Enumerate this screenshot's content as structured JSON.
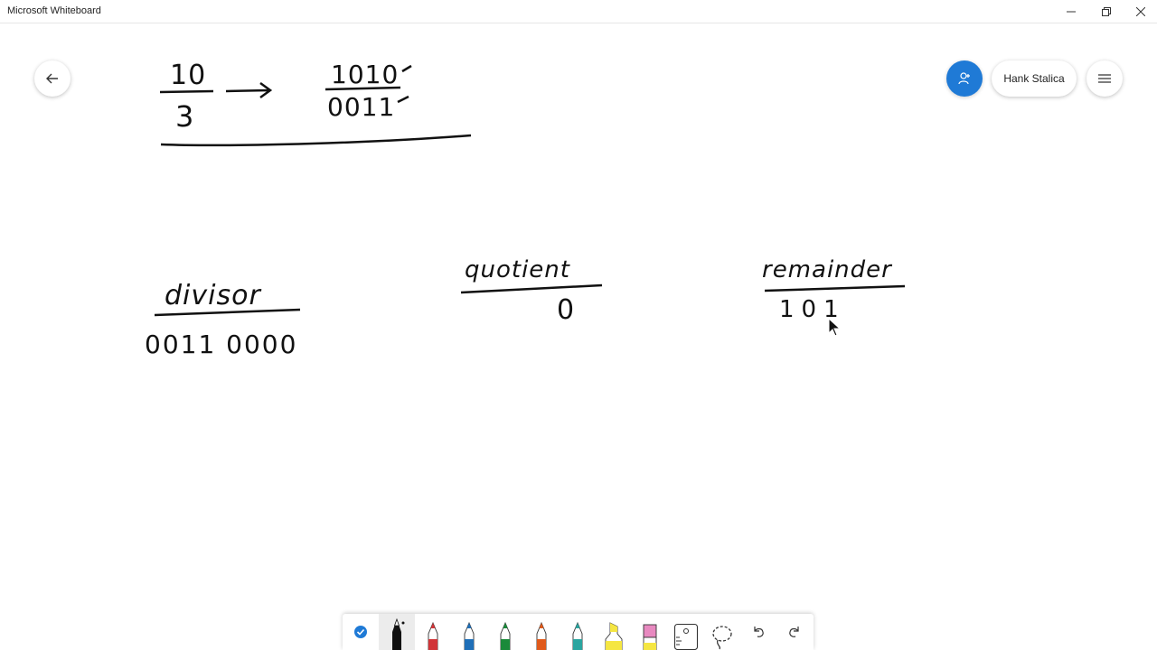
{
  "window": {
    "title": "Microsoft Whiteboard",
    "minimize_icon": "minimize-icon",
    "restore_icon": "restore-icon",
    "close_icon": "close-icon"
  },
  "header": {
    "back_icon": "back-arrow-icon",
    "user_name": "Hank Stalica",
    "invite_icon": "person-add-icon",
    "menu_icon": "hamburger-menu-icon",
    "accent_color": "#1f7ad6"
  },
  "board": {
    "fraction_numerator": "10",
    "fraction_denominator": "3",
    "binary_numerator": "1010",
    "binary_denominator": "0011",
    "divisor_label": "divisor",
    "divisor_value": "0011 0000",
    "quotient_label": "quotient",
    "quotient_value": "0",
    "remainder_label": "remainder",
    "remainder_value": "101"
  },
  "toolbar": {
    "tools": [
      {
        "name": "ink-to-shape-toggle",
        "icon": "checkmark-circle-icon",
        "color": "#1f7ad6"
      },
      {
        "name": "pen-black",
        "icon": "pen-icon",
        "color": "#111111",
        "selected": true
      },
      {
        "name": "pen-red",
        "icon": "pen-icon",
        "color": "#d13438"
      },
      {
        "name": "pen-blue",
        "icon": "pen-icon",
        "color": "#1f6fb8"
      },
      {
        "name": "pen-green",
        "icon": "pen-icon",
        "color": "#1a8a3a"
      },
      {
        "name": "pen-orange",
        "icon": "pen-icon",
        "color": "#e05a1b"
      },
      {
        "name": "pen-teal",
        "icon": "pen-icon",
        "color": "#2aa5a0"
      },
      {
        "name": "highlighter",
        "icon": "highlighter-icon",
        "color": "#f5e642"
      },
      {
        "name": "eraser",
        "icon": "eraser-icon",
        "color": "#e889c0"
      },
      {
        "name": "ruler",
        "icon": "ruler-icon",
        "color": "#444444"
      },
      {
        "name": "lasso",
        "icon": "lasso-icon",
        "color": "#444444"
      },
      {
        "name": "undo",
        "icon": "undo-icon",
        "color": "#444444"
      },
      {
        "name": "redo",
        "icon": "redo-icon",
        "color": "#444444"
      }
    ]
  }
}
